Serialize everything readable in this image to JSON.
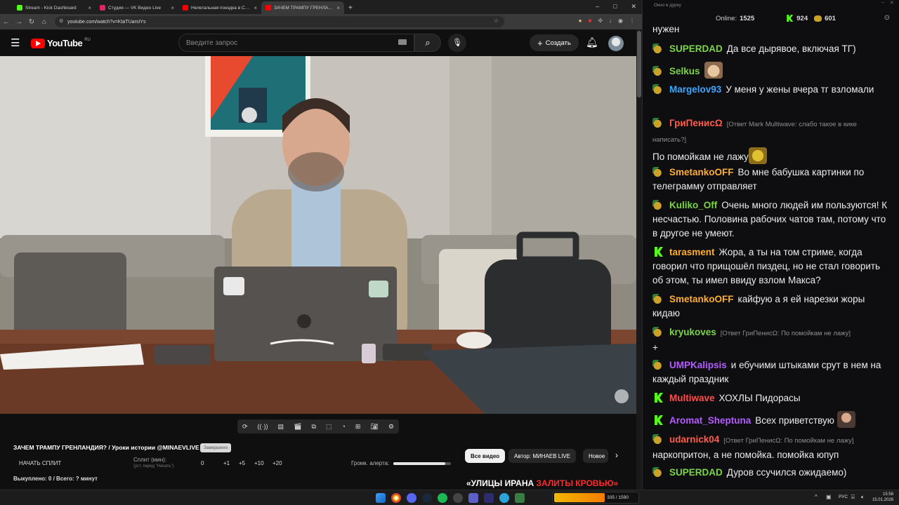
{
  "browser": {
    "tabs": [
      {
        "title": "Stream - Kick Dashboard",
        "color": "#53fc18"
      },
      {
        "title": "Студия — VK Видео Live",
        "color": "#e0245e"
      },
      {
        "title": "Нелегальная поездка в Сирию",
        "color": "#ff0000"
      },
      {
        "title": "ЗАЧЕМ ТРАМПУ ГРЕНЛАНДИЯ?",
        "color": "#ff0000"
      }
    ],
    "new_tab": "+",
    "url": "youtube.com/watch?v=KtaTUarsIYs"
  },
  "youtube": {
    "logo_text": "YouTube",
    "logo_region": "RU",
    "search_placeholder": "Введите запрос",
    "create_label": "Создать",
    "video_title": "ЗАЧЕМ ТРАМПУ ГРЕНЛАНДИЯ? / Уроки истории @MINAEVLIVE",
    "video_badge": "Завершено",
    "split_button": "НАЧАТЬ СПЛИТ",
    "split_label": "Сплит (мин):",
    "split_hint": "(уст. перед \"Начать\")",
    "split_value": "0",
    "split_steps": [
      "+1",
      "+5",
      "+10",
      "+20"
    ],
    "alert_volume_label": "Громк. алерта:",
    "alert_volume_level": 0.9,
    "bought_label": "Выкуплено: 0 / Всего: ? минут",
    "chips": [
      "Все видео",
      "Автор: МИНАЕВ LIVE",
      "Новое"
    ],
    "next_title_a": "«УЛИЦЫ ИРАНА ",
    "next_title_b": "ЗАЛИТЫ КРОВЬЮ»"
  },
  "chat": {
    "window_title": "Окно в дурку",
    "online_label": "Online:",
    "online_count": "1525",
    "kick_count": "924",
    "other_count": "601",
    "top_fragment": "нужен",
    "messages": [
      {
        "platform": "yt",
        "nick": "SUPERDAD",
        "color": "#7bd548",
        "reply": "",
        "text": "Да все дырявое, включая ТГ)"
      },
      {
        "platform": "yt",
        "nick": "Selkus",
        "color": "#7bd548",
        "reply": "",
        "text": ""
      },
      {
        "platform": "yt",
        "nick": "Margelov93",
        "color": "#3ea6ff",
        "reply": "",
        "text": "У меня у жены вчера тг взломали"
      },
      {
        "platform": "yt",
        "nick": "ГриПенисΩ",
        "color": "#ff5c4c",
        "reply": "[Ответ Mark Multiwave: слабо такое в кике написать?]",
        "text": "По помойкам не лажу"
      },
      {
        "platform": "yt",
        "nick": "SmetankoOFF",
        "color": "#ffae2f",
        "reply": "",
        "text": "Во мне бабушка картинки по телеграмму отправляет"
      },
      {
        "platform": "yt",
        "nick": "Kuliko_Off",
        "color": "#7bd548",
        "reply": "",
        "text": "Очень много людей им пользуются! К несчастью. Половина рабочих чатов там, потому что в другое не умеют."
      },
      {
        "platform": "kick",
        "nick": "tarasment",
        "color": "#ffae2f",
        "reply": "",
        "text": "Жора, а ты на том стриме, когда говорил что прищошёл пиздец, но не стал говорить об этом, ты имел ввиду взлом Макса?"
      },
      {
        "platform": "yt",
        "nick": "SmetankoOFF",
        "color": "#ffae2f",
        "reply": "",
        "text": "кайфую а я ей нарезки жоры кидаю"
      },
      {
        "platform": "yt",
        "nick": "kryukoves",
        "color": "#7bd548",
        "reply": "[Ответ ГриПенисΩ: По помойкам не лажу]",
        "text": "+"
      },
      {
        "platform": "yt",
        "nick": "UMPKalipsis",
        "color": "#b45cff",
        "reply": "",
        "text": "и ебучими штыками срут в нем на каждый праздник"
      },
      {
        "platform": "kick",
        "nick": "Multiwave",
        "color": "#ff4d4d",
        "reply": "",
        "text": "ХОХЛЫ Пидорасы"
      },
      {
        "platform": "kick",
        "nick": "Aromat_Sheptuna",
        "color": "#b45cff",
        "reply": "",
        "text": "Всех приветствую"
      },
      {
        "platform": "yt",
        "nick": "udarnick04",
        "color": "#ff5c4c",
        "reply": "[Ответ ГриПенисΩ: По помойкам не лажу]",
        "text": "наркопритон, а не помойка. помойка юпуп"
      },
      {
        "platform": "yt",
        "nick": "SUPERDAD",
        "color": "#7bd548",
        "reply": "",
        "text": "Дуров ссучился ожидаемо)"
      }
    ]
  },
  "taskbar": {
    "kick_widget": "335 / 1590",
    "lang": "РУС",
    "time": "15:58",
    "date": "15.01.2026"
  }
}
